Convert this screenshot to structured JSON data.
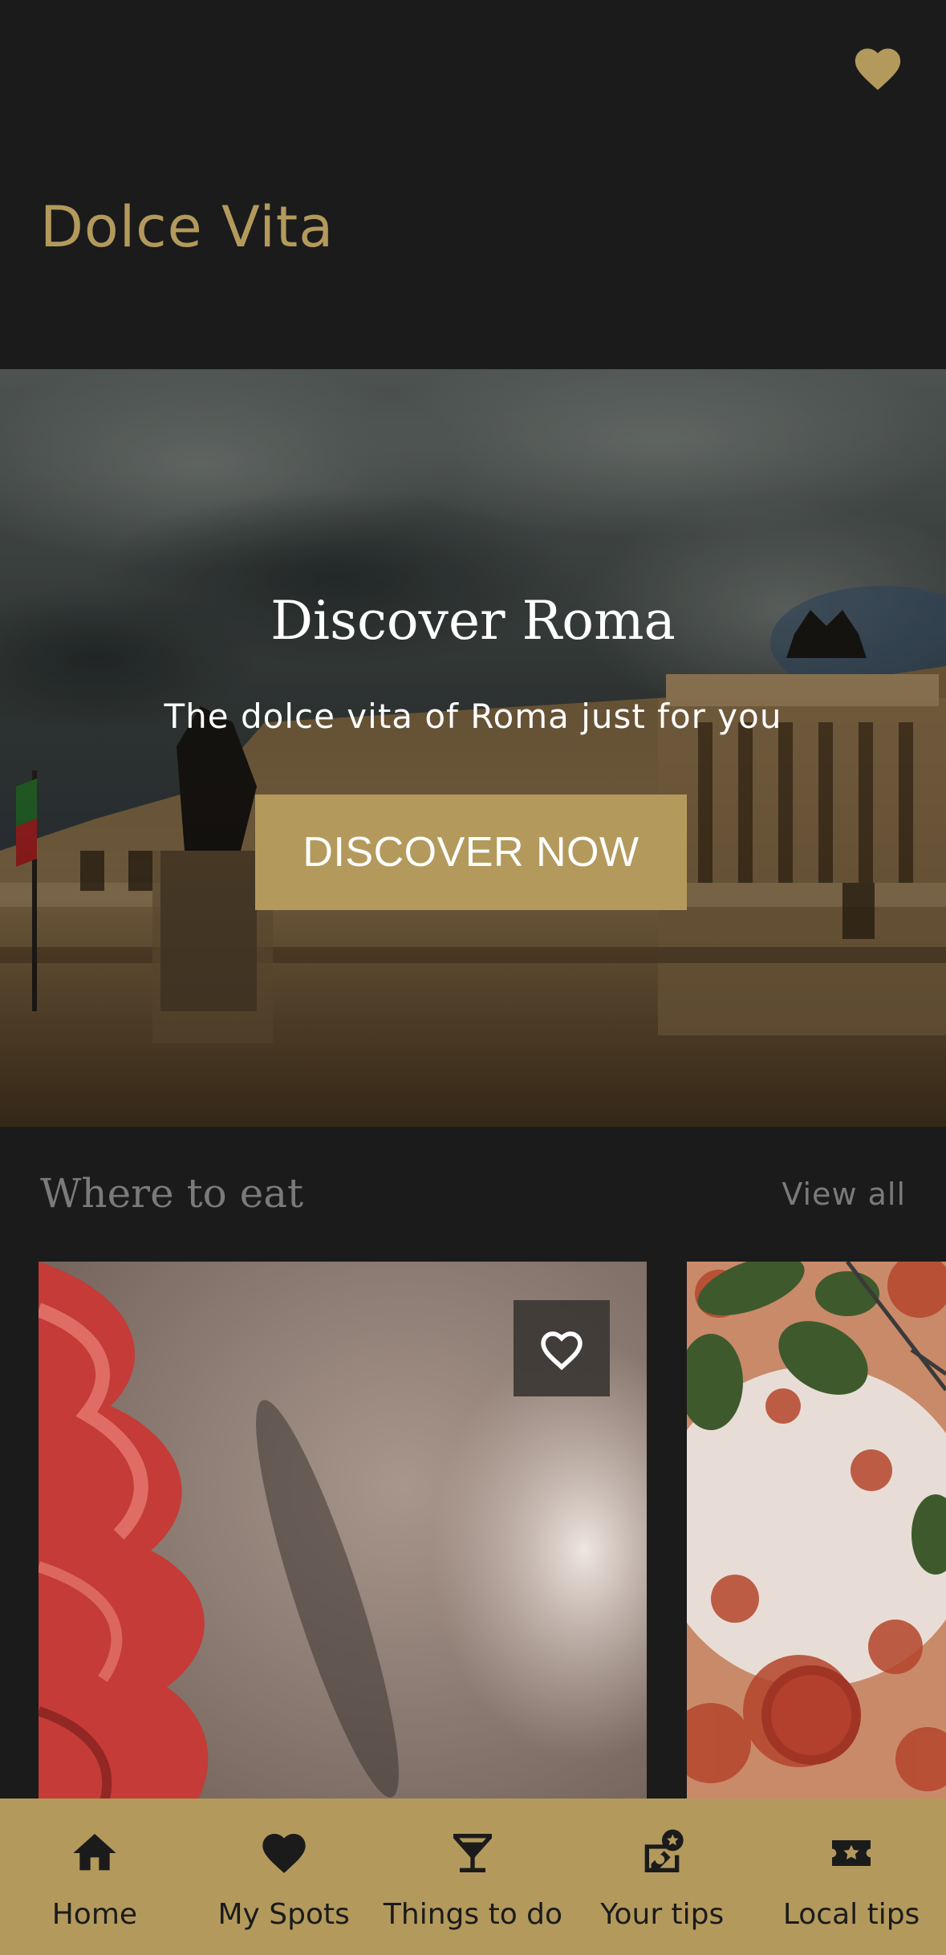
{
  "header": {
    "app_title": "Dolce Vita",
    "favorite_icon": "heart-icon"
  },
  "hero": {
    "title": "Discover Roma",
    "subtitle": "The dolce vita of Roma just for you",
    "cta_label": "DISCOVER NOW"
  },
  "where_to_eat": {
    "title": "Where to eat",
    "view_all_label": "View all",
    "cards": [
      {
        "favorite_icon": "heart-outline-icon"
      },
      {}
    ]
  },
  "bottom_nav": {
    "items": [
      {
        "label": "Home",
        "icon": "home-icon"
      },
      {
        "label": "My Spots",
        "icon": "heart-icon"
      },
      {
        "label": "Things to do",
        "icon": "cocktail-icon"
      },
      {
        "label": "Your tips",
        "icon": "tip-edit-icon"
      },
      {
        "label": "Local tips",
        "icon": "star-ticket-icon"
      }
    ]
  },
  "colors": {
    "background": "#1b1b1b",
    "accent": "#b39a5c",
    "muted_text": "#7a7a7a"
  }
}
